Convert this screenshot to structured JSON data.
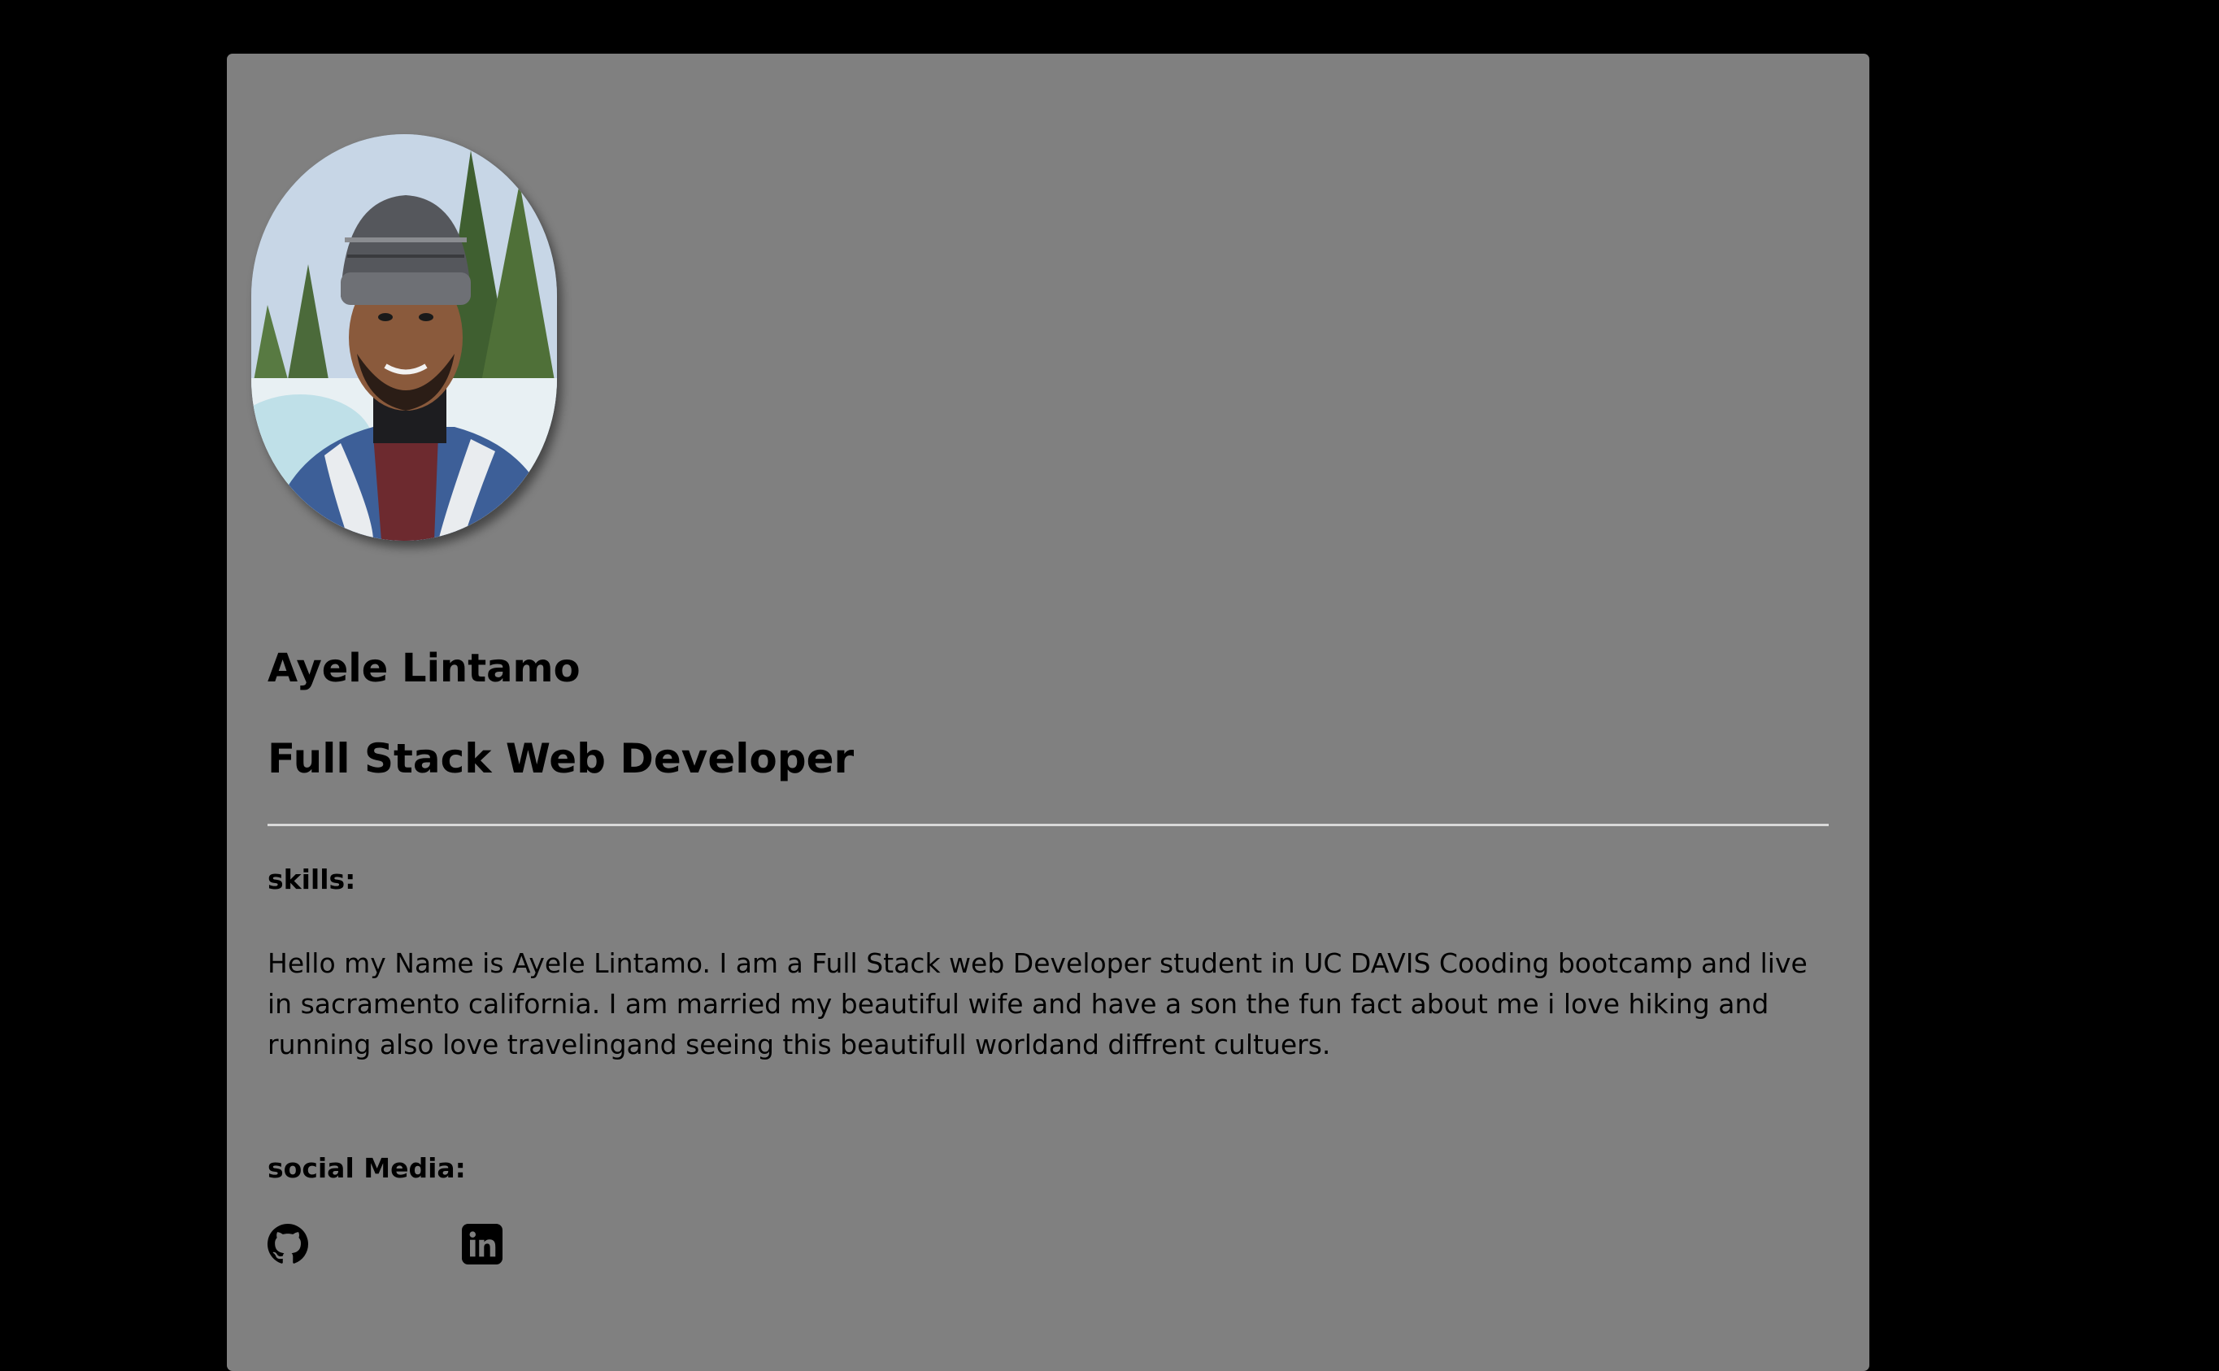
{
  "profile": {
    "name": "Ayele Lintamo",
    "role": "Full Stack Web Developer",
    "photo_icon": "profile-photo"
  },
  "skills": {
    "heading": "skills:",
    "bio": "Hello my Name is Ayele Lintamo. I am a Full Stack web Developer student in UC DAVIS Cooding bootcamp and live in sacramento california. I am married my beautiful wife and have a son the fun fact about me i love hiking and running also love travelingand seeing this beautifull worldand diffrent cultuers."
  },
  "social": {
    "heading": "social Media:",
    "links": [
      {
        "icon": "github-icon"
      },
      {
        "icon": "linkedin-icon"
      }
    ]
  },
  "colors": {
    "page_background": "#000000",
    "card_background": "#808080",
    "text": "#000000",
    "divider": "#d9d9d9"
  }
}
